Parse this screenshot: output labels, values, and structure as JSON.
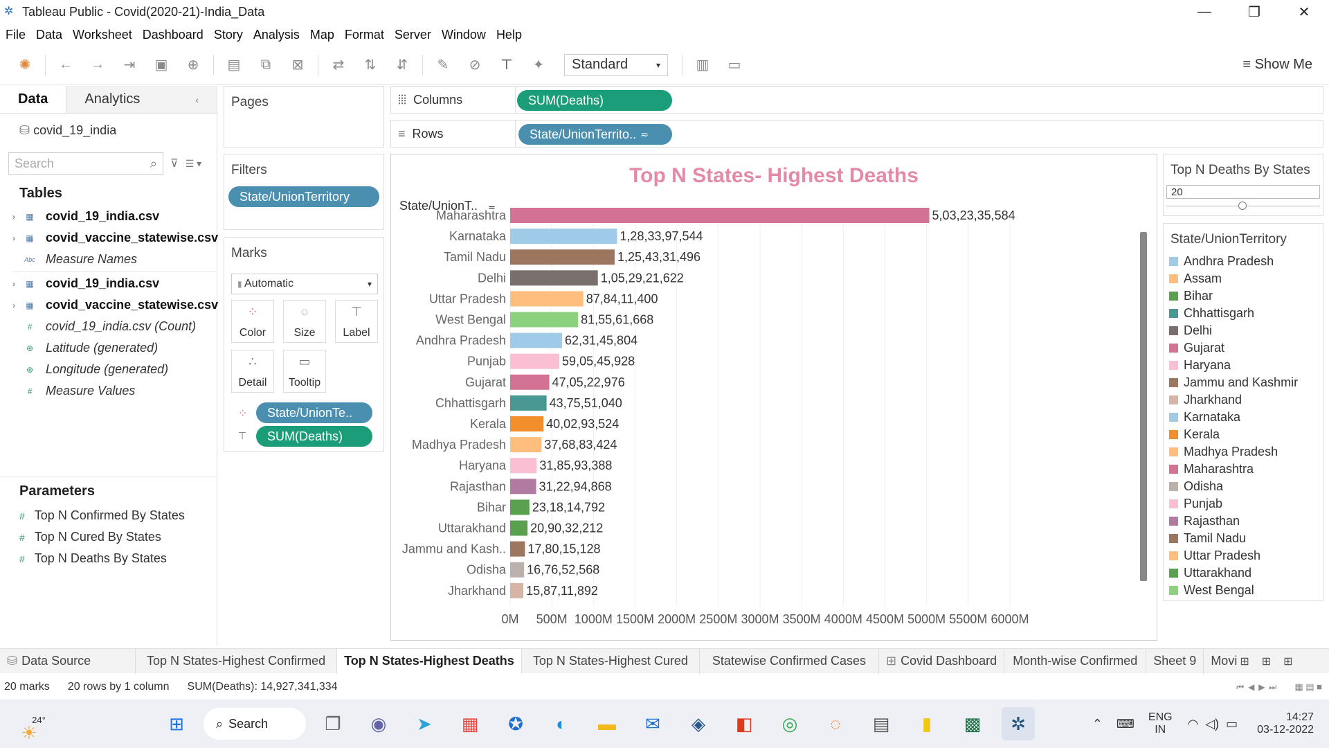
{
  "window": {
    "title": "Tableau Public - Covid(2020-21)-India_Data"
  },
  "menu": [
    "File",
    "Data",
    "Worksheet",
    "Dashboard",
    "Story",
    "Analysis",
    "Map",
    "Format",
    "Server",
    "Window",
    "Help"
  ],
  "toolbar": {
    "fit": "Standard",
    "show_me": "Show Me"
  },
  "data_pane": {
    "tab_data": "Data",
    "tab_analytics": "Analytics",
    "source": "covid_19_india",
    "search_placeholder": "Search",
    "tables_header": "Tables",
    "fields": [
      {
        "label": "covid_19_india.csv"
      },
      {
        "label": "covid_vaccine_statewise.csv"
      },
      {
        "label": "Measure Names"
      },
      {
        "label": "covid_19_india.csv"
      },
      {
        "label": "covid_vaccine_statewise.csv"
      },
      {
        "label": "covid_19_india.csv (Count)"
      },
      {
        "label": "Latitude (generated)"
      },
      {
        "label": "Longitude (generated)"
      },
      {
        "label": "Measure Values"
      }
    ],
    "parameters_header": "Parameters",
    "parameters": [
      "Top N Confirmed By States",
      "Top N Cured By States",
      "Top N Deaths By States"
    ]
  },
  "cards": {
    "pages": "Pages",
    "filters": "Filters",
    "filter_pill": "State/UnionTerritory",
    "marks": "Marks",
    "mark_type": "Automatic",
    "mark_buttons": [
      "Color",
      "Size",
      "Label",
      "Detail",
      "Tooltip"
    ],
    "mark_pill_color": "State/UnionTe..",
    "mark_pill_label": "SUM(Deaths)"
  },
  "shelves": {
    "columns_label": "Columns",
    "columns_pill": "SUM(Deaths)",
    "rows_label": "Rows",
    "rows_pill": "State/UnionTerrito.."
  },
  "parameter_card": {
    "title": "Top N Deaths By States",
    "value": "20"
  },
  "legend": {
    "title": "State/UnionTerritory",
    "items": [
      {
        "name": "Andhra Pradesh",
        "color": "#a0cbe8"
      },
      {
        "name": "Assam",
        "color": "#ffbe7d"
      },
      {
        "name": "Bihar",
        "color": "#59a14f"
      },
      {
        "name": "Chhattisgarh",
        "color": "#499894"
      },
      {
        "name": "Delhi",
        "color": "#79706e"
      },
      {
        "name": "Gujarat",
        "color": "#d37295"
      },
      {
        "name": "Haryana",
        "color": "#fabfd2"
      },
      {
        "name": "Jammu and Kashmir",
        "color": "#9d7660"
      },
      {
        "name": "Jharkhand",
        "color": "#d7b5a6"
      },
      {
        "name": "Karnataka",
        "color": "#a0cbe8"
      },
      {
        "name": "Kerala",
        "color": "#f28e2b"
      },
      {
        "name": "Madhya Pradesh",
        "color": "#ffbe7d"
      },
      {
        "name": "Maharashtra",
        "color": "#d37295"
      },
      {
        "name": "Odisha",
        "color": "#bab0ac"
      },
      {
        "name": "Punjab",
        "color": "#fabfd2"
      },
      {
        "name": "Rajasthan",
        "color": "#b07aa1"
      },
      {
        "name": "Tamil Nadu",
        "color": "#9d7660"
      },
      {
        "name": "Uttar Pradesh",
        "color": "#ffbe7d"
      },
      {
        "name": "Uttarakhand",
        "color": "#59a14f"
      },
      {
        "name": "West Bengal",
        "color": "#8cd17d"
      }
    ]
  },
  "chart_data": {
    "type": "bar",
    "title": "Top N States- Highest Deaths",
    "row_header": "State/UnionT..",
    "categories": [
      "Maharashtra",
      "Karnataka",
      "Tamil Nadu",
      "Delhi",
      "Uttar Pradesh",
      "West Bengal",
      "Andhra Pradesh",
      "Punjab",
      "Gujarat",
      "Chhattisgarh",
      "Kerala",
      "Madhya Pradesh",
      "Haryana",
      "Rajasthan",
      "Bihar",
      "Uttarakhand",
      "Jammu and Kash..",
      "Odisha",
      "Jharkhand"
    ],
    "values": [
      5032335584,
      1283397544,
      1254331496,
      1052921622,
      878411400,
      815561668,
      623145804,
      590545928,
      470522976,
      437551040,
      400293524,
      376883424,
      318593388,
      312294868,
      231814792,
      209032212,
      178015128,
      167652568,
      158711892
    ],
    "labels": [
      "5,03,23,35,584",
      "1,28,33,97,544",
      "1,25,43,31,496",
      "1,05,29,21,622",
      "87,84,11,400",
      "81,55,61,668",
      "62,31,45,804",
      "59,05,45,928",
      "47,05,22,976",
      "43,75,51,040",
      "40,02,93,524",
      "37,68,83,424",
      "31,85,93,388",
      "31,22,94,868",
      "23,18,14,792",
      "20,90,32,212",
      "17,80,15,128",
      "16,76,52,568",
      "15,87,11,892"
    ],
    "colors": [
      "#d37295",
      "#a0cbe8",
      "#9d7660",
      "#79706e",
      "#ffbe7d",
      "#8cd17d",
      "#a0cbe8",
      "#fabfd2",
      "#d37295",
      "#499894",
      "#f28e2b",
      "#ffbe7d",
      "#fabfd2",
      "#b07aa1",
      "#59a14f",
      "#59a14f",
      "#9d7660",
      "#bab0ac",
      "#d7b5a6"
    ],
    "xticks": [
      "0M",
      "500M",
      "1000M",
      "1500M",
      "2000M",
      "2500M",
      "3000M",
      "3500M",
      "4000M",
      "4500M",
      "5000M",
      "5500M",
      "6000M"
    ],
    "xlim": [
      0,
      6000000000
    ],
    "title_color": "#e48aa8"
  },
  "sheet_tabs": [
    "Data Source",
    "Top N States-Highest Confirmed",
    "Top N States-Highest Deaths",
    "Top N States-Highest Cured",
    "Statewise Confirmed Cases",
    "Covid Dashboard",
    "Month-wise Confirmed",
    "Sheet 9",
    "Movi"
  ],
  "status": {
    "marks": "20 marks",
    "rows": "20 rows by 1 column",
    "sum": "SUM(Deaths): 14,927,341,334"
  },
  "taskbar": {
    "weather": "24°",
    "search": "Search",
    "lang1": "ENG",
    "lang2": "IN",
    "time": "14:27",
    "date": "03-12-2022"
  }
}
